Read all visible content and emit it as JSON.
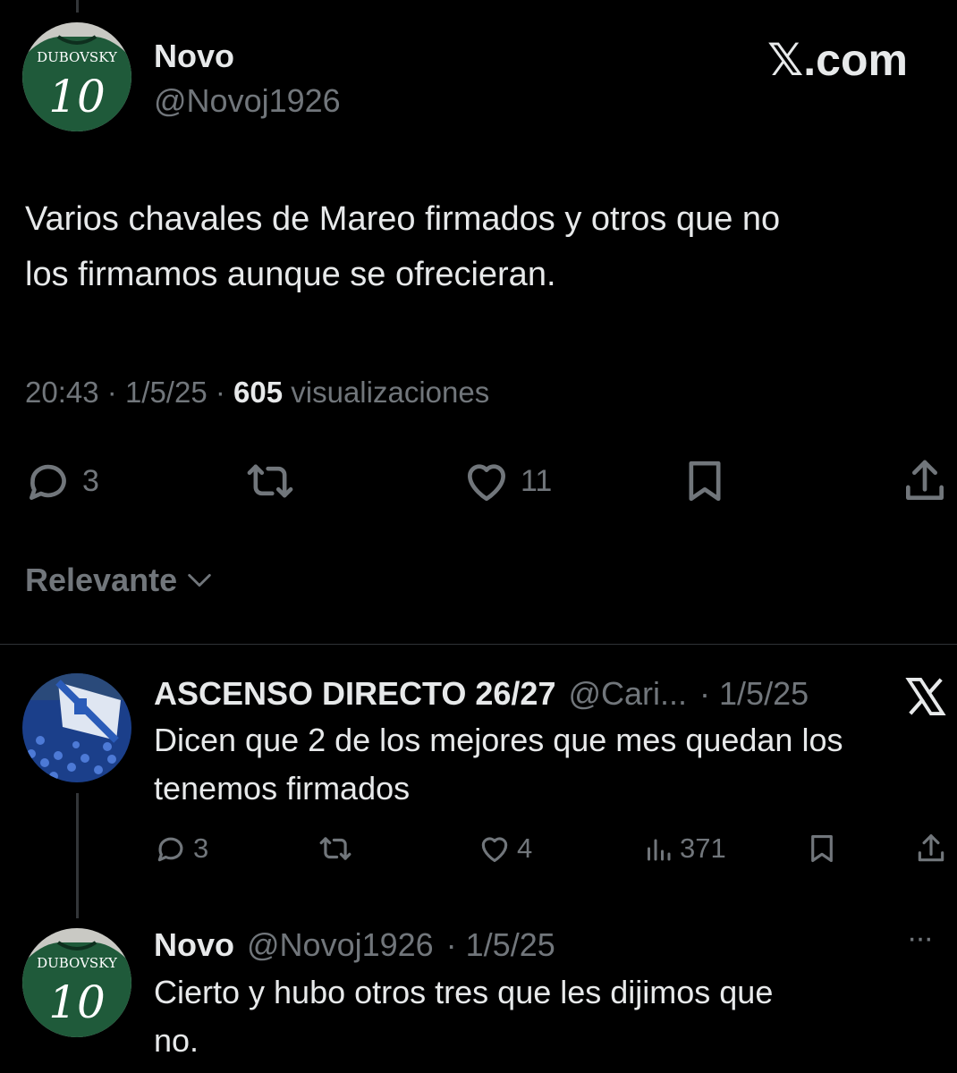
{
  "main_tweet": {
    "author_name": "Novo",
    "author_handle": "@Novoj1926",
    "avatar_jersey_text": "DUBOVSKY",
    "avatar_number": "10",
    "brand": "𝕏.com",
    "text_line1": "Varios chavales de Mareo firmados y otros que no",
    "text_line2": "los firmamos aunque se ofrecieran.",
    "time": "20:43",
    "date": "1/5/25",
    "views_count": "605",
    "views_label": "visualizaciones",
    "separator": "·",
    "replies": "3",
    "likes": "11"
  },
  "sort": {
    "label": "Relevante"
  },
  "replies": [
    {
      "author_name": "ASCENSO DIRECTO 26/27",
      "author_handle": "@Cari...",
      "date": "· 1/5/25",
      "text_line1": "Dicen que 2 de los mejores que mes quedan los",
      "text_line2": "tenemos firmados",
      "replies": "3",
      "likes": "4",
      "views": "371",
      "corner_icon": "x-logo"
    },
    {
      "author_name": "Novo",
      "author_handle": "@Novoj1926",
      "date": "· 1/5/25",
      "avatar_jersey_text": "DUBOVSKY",
      "avatar_number": "10",
      "text_line1": "Cierto y hubo otros tres que les dijimos que",
      "text_line2": "no.",
      "more": "···"
    }
  ],
  "colors": {
    "background": "#000000",
    "text": "#e7e9ea",
    "muted": "#71767b",
    "divider": "#2f3336",
    "jersey_green": "#1f5a3a"
  }
}
